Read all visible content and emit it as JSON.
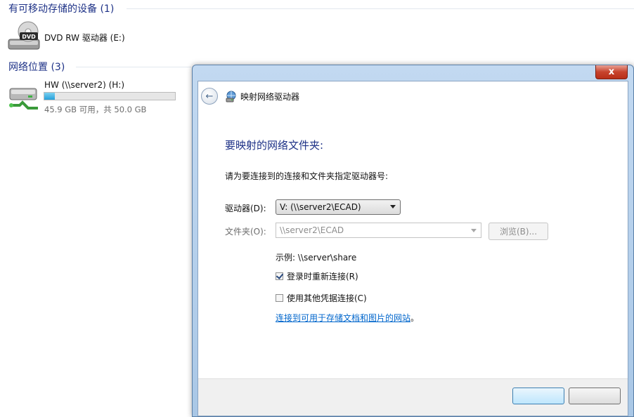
{
  "explorer": {
    "removable_group": {
      "title": "有可移动存储的设备 (1)"
    },
    "dvd_drive": {
      "name": "DVD RW 驱动器 (E:)",
      "icon_label": "DVD"
    },
    "network_group": {
      "title": "网络位置 (3)"
    },
    "network_drive": {
      "name": "HW (\\\\server2) (H:)",
      "space": "45.9 GB 可用，共 50.0 GB",
      "used_fraction": 0.082
    }
  },
  "dialog": {
    "title": "映射网络驱动器",
    "heading": "要映射的网络文件夹:",
    "instruction": "请为要连接到的连接和文件夹指定驱动器号:",
    "drive_label": "驱动器(D):",
    "drive_value": "V: (\\\\server2\\ECAD)",
    "folder_label": "文件夹(O):",
    "folder_value": "\\\\server2\\ECAD",
    "browse_label": "浏览(B)...",
    "example": "示例: \\\\server\\share",
    "reconnect_label": "登录时重新连接(R)",
    "reconnect_checked": true,
    "other_creds_label": "使用其他凭据连接(C)",
    "other_creds_checked": false,
    "link_text": "连接到可用于存储文档和图片的网站",
    "link_suffix": "。",
    "close_glyph": "x"
  },
  "colors": {
    "group_header": "#1e3287",
    "link": "#0066cc",
    "close": "#c7432c"
  }
}
